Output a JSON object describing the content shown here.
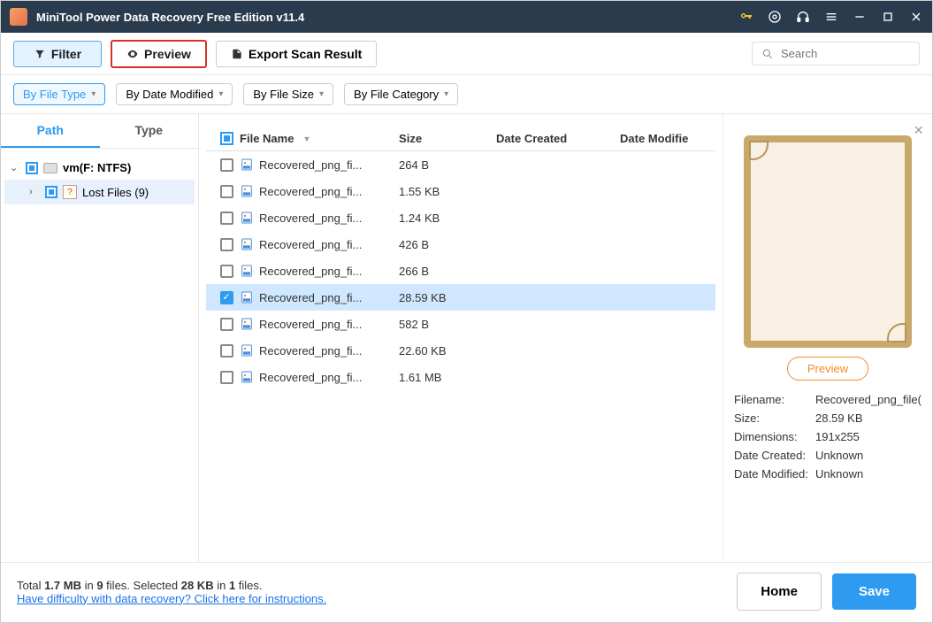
{
  "window": {
    "title": "MiniTool Power Data Recovery Free Edition v11.4"
  },
  "toolbar": {
    "filter": "Filter",
    "preview": "Preview",
    "export": "Export Scan Result",
    "search_placeholder": "Search"
  },
  "filters": {
    "file_type": "By File Type",
    "date_modified": "By Date Modified",
    "file_size": "By File Size",
    "file_category": "By File Category"
  },
  "tabs": {
    "path": "Path",
    "type": "Type"
  },
  "tree": {
    "root": "vm(F: NTFS)",
    "child": "Lost Files (9)"
  },
  "columns": {
    "name": "File Name",
    "size": "Size",
    "created": "Date Created",
    "modified": "Date Modifie"
  },
  "files": [
    {
      "name": "Recovered_png_fi...",
      "size": "264 B",
      "selected": false
    },
    {
      "name": "Recovered_png_fi...",
      "size": "1.55 KB",
      "selected": false
    },
    {
      "name": "Recovered_png_fi...",
      "size": "1.24 KB",
      "selected": false
    },
    {
      "name": "Recovered_png_fi...",
      "size": "426 B",
      "selected": false
    },
    {
      "name": "Recovered_png_fi...",
      "size": "266 B",
      "selected": false
    },
    {
      "name": "Recovered_png_fi...",
      "size": "28.59 KB",
      "selected": true
    },
    {
      "name": "Recovered_png_fi...",
      "size": "582 B",
      "selected": false
    },
    {
      "name": "Recovered_png_fi...",
      "size": "22.60 KB",
      "selected": false
    },
    {
      "name": "Recovered_png_fi...",
      "size": "1.61 MB",
      "selected": false
    }
  ],
  "preview": {
    "button": "Preview",
    "filename_label": "Filename:",
    "filename": "Recovered_png_file(",
    "size_label": "Size:",
    "size": "28.59 KB",
    "dim_label": "Dimensions:",
    "dim": "191x255",
    "created_label": "Date Created:",
    "created": "Unknown",
    "modified_label": "Date Modified:",
    "modified": "Unknown"
  },
  "footer": {
    "total_prefix": "Total ",
    "total_size": "1.7 MB",
    "total_mid": " in ",
    "total_count": "9",
    "total_suffix": " files. ",
    "sel_prefix": "Selected ",
    "sel_size": "28 KB",
    "sel_mid": " in ",
    "sel_count": "1",
    "sel_suffix": " files.",
    "help": "Have difficulty with data recovery? Click here for instructions.",
    "home": "Home",
    "save": "Save"
  }
}
